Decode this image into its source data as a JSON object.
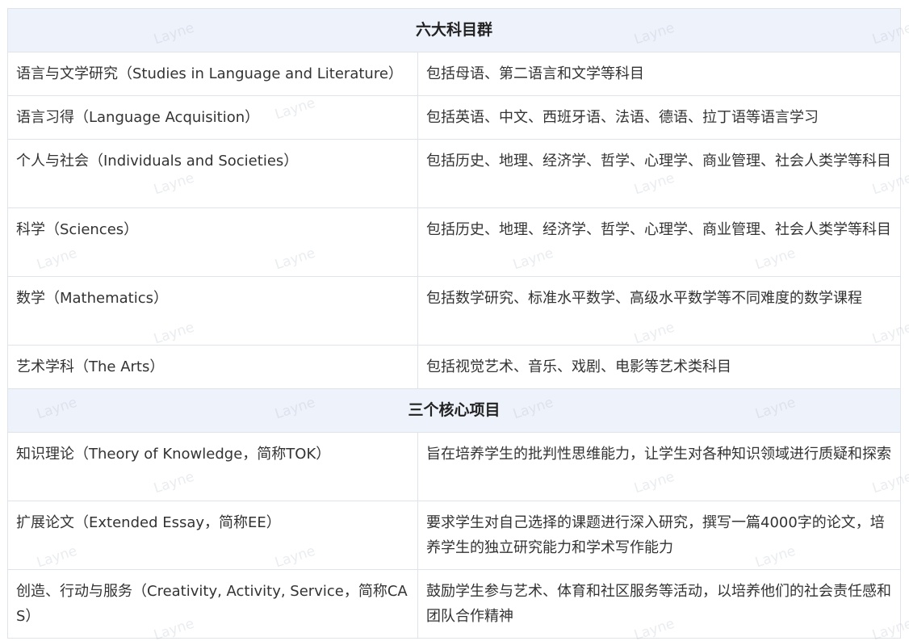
{
  "sections": [
    {
      "title": "六大科目群",
      "rows": [
        {
          "name": "语言与文学研究（Studies in Language and Literature）",
          "desc": "包括母语、第二语言和文学等科目"
        },
        {
          "name": "语言习得（Language Acquisition）",
          "desc": "包括英语、中文、西班牙语、法语、德语、拉丁语等语言学习"
        },
        {
          "name": "个人与社会（Individuals and Societies）",
          "desc": "包括历史、地理、经济学、哲学、心理学、商业管理、社会人类学等科目"
        },
        {
          "name": "科学（Sciences）",
          "desc": "包括历史、地理、经济学、哲学、心理学、商业管理、社会人类学等科目"
        },
        {
          "name": "数学（Mathematics）",
          "desc": "包括数学研究、标准水平数学、高级水平数学等不同难度的数学课程"
        },
        {
          "name": "艺术学科（The Arts）",
          "desc": "包括视觉艺术、音乐、戏剧、电影等艺术类科目"
        }
      ]
    },
    {
      "title": "三个核心项目",
      "rows": [
        {
          "name": "知识理论（Theory of Knowledge，简称TOK）",
          "desc": "旨在培养学生的批判性思维能力，让学生对各种知识领域进行质疑和探索"
        },
        {
          "name": "扩展论文（Extended Essay，简称EE）",
          "desc": "要求学生对自己选择的课题进行深入研究，撰写一篇4000字的论文，培养学生的独立研究能力和学术写作能力"
        },
        {
          "name": "创造、行动与服务（Creativity, Activity, Service，简称CAS）",
          "desc": "鼓励学生参与艺术、体育和社区服务等活动，以培养他们的社会责任感和团队合作精神"
        }
      ]
    }
  ],
  "watermark": "Layne"
}
